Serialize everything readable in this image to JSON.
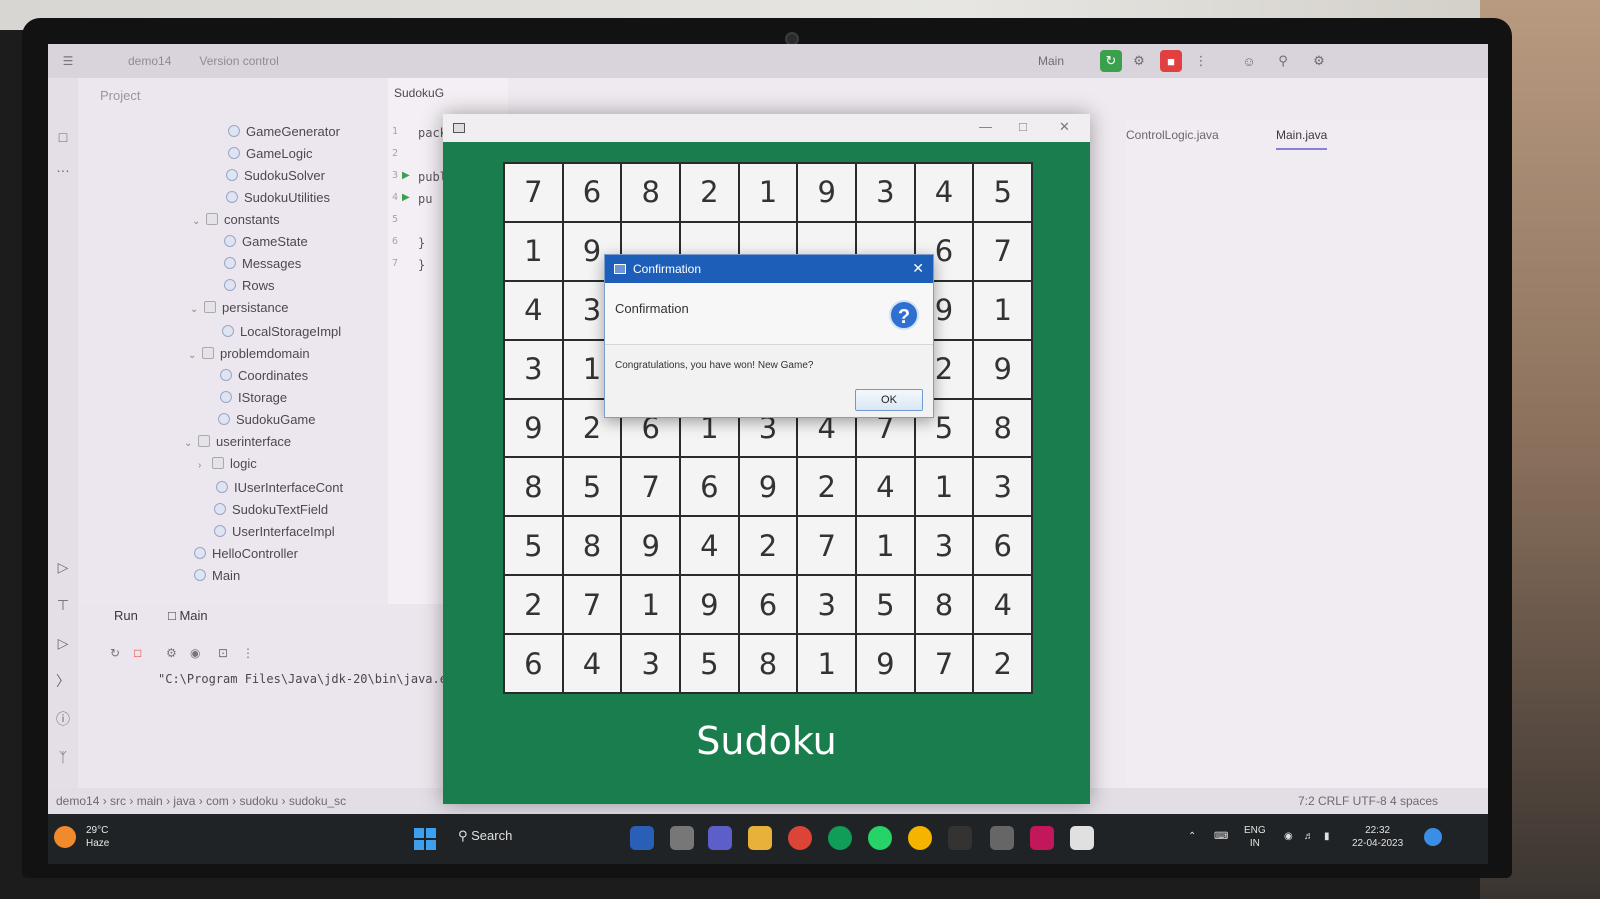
{
  "ide": {
    "project_name": "demo14",
    "version_control": "Version control",
    "project_label": "Project",
    "run_config": "Main",
    "tree": [
      {
        "label": "GameGenerator",
        "type": "class"
      },
      {
        "label": "GameLogic",
        "type": "class"
      },
      {
        "label": "SudokuSolver",
        "type": "class"
      },
      {
        "label": "SudokuUtilities",
        "type": "class"
      },
      {
        "label": "constants",
        "type": "folder"
      },
      {
        "label": "GameState",
        "type": "class"
      },
      {
        "label": "Messages",
        "type": "class"
      },
      {
        "label": "Rows",
        "type": "class"
      },
      {
        "label": "persistance",
        "type": "folder"
      },
      {
        "label": "LocalStorageImpl",
        "type": "class"
      },
      {
        "label": "problemdomain",
        "type": "folder"
      },
      {
        "label": "Coordinates",
        "type": "class"
      },
      {
        "label": "IStorage",
        "type": "interface"
      },
      {
        "label": "SudokuGame",
        "type": "class"
      },
      {
        "label": "userinterface",
        "type": "folder"
      },
      {
        "label": "logic",
        "type": "folder"
      },
      {
        "label": "IUserInterfaceCont",
        "type": "interface"
      },
      {
        "label": "SudokuTextField",
        "type": "class"
      },
      {
        "label": "UserInterfaceImpl",
        "type": "class"
      },
      {
        "label": "HelloController",
        "type": "class"
      },
      {
        "label": "Main",
        "type": "class"
      }
    ],
    "editor_tab": "SudokuG",
    "code_lines": [
      {
        "num": "1",
        "text": "packag"
      },
      {
        "num": "2",
        "text": ""
      },
      {
        "num": "3",
        "text": "public"
      },
      {
        "num": "4",
        "text": "  pu"
      },
      {
        "num": "5",
        "text": ""
      },
      {
        "num": "6",
        "text": "  }"
      },
      {
        "num": "7",
        "text": "}"
      }
    ],
    "right_tabs": [
      "ControlLogic.java",
      "Main.java"
    ],
    "run_tab": "Run",
    "run_config_tab": "Main",
    "console_line": "\"C:\\Program Files\\Java\\jdk-20\\bin\\java.exe\"",
    "breadcrumbs": [
      "demo14",
      "src",
      "main",
      "java",
      "com",
      "sudoku",
      "sudoku_sc"
    ],
    "status_right": "7:2   CRLF   UTF-8   4 spaces"
  },
  "game": {
    "title": "Sudoku",
    "grid": [
      [
        "7",
        "6",
        "8",
        "2",
        "1",
        "9",
        "3",
        "4",
        "5"
      ],
      [
        "1",
        "9",
        "",
        "",
        "",
        "",
        "",
        "6",
        "7"
      ],
      [
        "4",
        "3",
        "",
        "",
        "",
        "",
        "",
        "9",
        "1"
      ],
      [
        "3",
        "1",
        "",
        "",
        "",
        "",
        "",
        "2",
        "9"
      ],
      [
        "9",
        "2",
        "6",
        "1",
        "3",
        "4",
        "7",
        "5",
        "8"
      ],
      [
        "8",
        "5",
        "7",
        "6",
        "9",
        "2",
        "4",
        "1",
        "3"
      ],
      [
        "5",
        "8",
        "9",
        "4",
        "2",
        "7",
        "1",
        "3",
        "6"
      ],
      [
        "2",
        "7",
        "1",
        "9",
        "6",
        "3",
        "5",
        "8",
        "4"
      ],
      [
        "6",
        "4",
        "3",
        "5",
        "8",
        "1",
        "9",
        "7",
        "2"
      ]
    ]
  },
  "dialog": {
    "window_title": "Confirmation",
    "header": "Confirmation",
    "message": "Congratulations, you have won! New Game?",
    "ok_label": "OK"
  },
  "taskbar": {
    "temperature": "29°C",
    "weather": "Haze",
    "search": "Search",
    "language": "ENG",
    "region": "IN",
    "time": "22:32",
    "date": "22-04-2023"
  }
}
